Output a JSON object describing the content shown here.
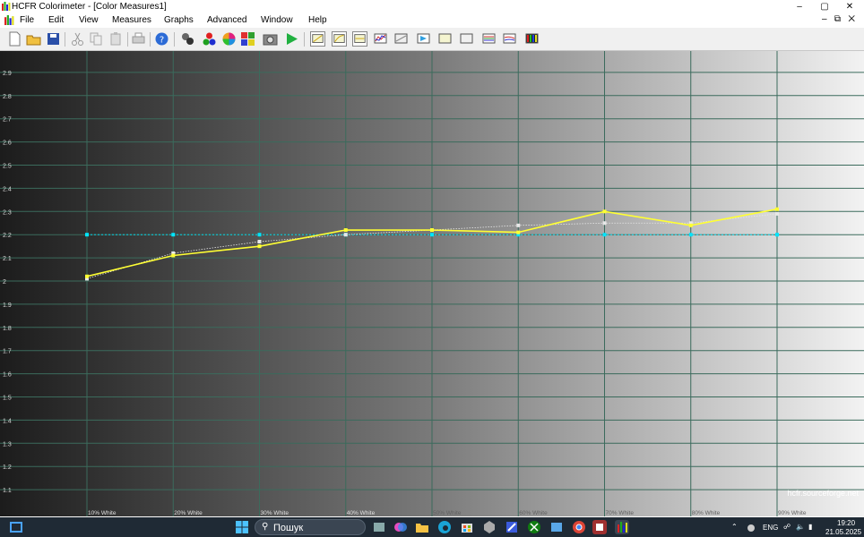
{
  "window": {
    "title": "HCFR Colorimeter - [Color Measures1]"
  },
  "window_controls": {
    "minimize": "–",
    "maximize": "▢",
    "close": "✕"
  },
  "menu": [
    "File",
    "Edit",
    "View",
    "Measures",
    "Graphs",
    "Advanced",
    "Window",
    "Help"
  ],
  "mdi_controls": {
    "minimize": "–",
    "restore": "⧉",
    "close": "✕"
  },
  "toolbar_icons": [
    "new-file-icon",
    "open-folder-icon",
    "save-icon",
    "cut-icon",
    "copy-icon",
    "paste-icon",
    "print-icon",
    "help-icon",
    "sensor-icon",
    "rgb-balls-icon",
    "color-wheel-icon",
    "gamut-icon",
    "camera-icon",
    "play-icon",
    "graph-icon-1",
    "graph-icon-2",
    "graph-icon-3",
    "graph-icon-4",
    "graph-icon-5",
    "graph-icon-6",
    "graph-icon-7",
    "graph-icon-8",
    "graph-icon-9",
    "graph-icon-10",
    "graph-icon-11"
  ],
  "colors": {
    "measured_line": "#ffff33",
    "target_line": "#00e5ff",
    "reference_line": "#e8e8e8",
    "grid": "#3b6b5c",
    "taskbar": "#1f2a35"
  },
  "chart_data": {
    "type": "line",
    "categories": [
      "10% White",
      "20% White",
      "30% White",
      "40% White",
      "50% White",
      "60% White",
      "70% White",
      "80% White",
      "90% White"
    ],
    "series": [
      {
        "values": [
          2.02,
          2.11,
          2.15,
          2.22,
          2.22,
          2.21,
          2.3,
          2.24,
          2.31
        ]
      },
      {
        "values": [
          2.2,
          2.2,
          2.2,
          2.2,
          2.2,
          2.2,
          2.2,
          2.2,
          2.2
        ]
      },
      {
        "values": [
          2.01,
          2.12,
          2.17,
          2.2,
          2.22,
          2.24,
          2.25,
          2.25,
          2.29
        ]
      }
    ],
    "yticks": [
      "2.9",
      "2.8",
      "2.7",
      "2.6",
      "2.5",
      "2.4",
      "2.3",
      "2.2",
      "2.1",
      "2",
      "1.9",
      "1.8",
      "1.7",
      "1.6",
      "1.5",
      "1.4",
      "1.3",
      "1.2",
      "1.1"
    ],
    "ylim": [
      1.0,
      3.0
    ],
    "grid": true,
    "watermark": "hcfr.sourceforge.net"
  },
  "taskbar": {
    "search_placeholder": "Пошук",
    "language": "ENG",
    "time": "19:20",
    "date": "21.05.2025"
  }
}
